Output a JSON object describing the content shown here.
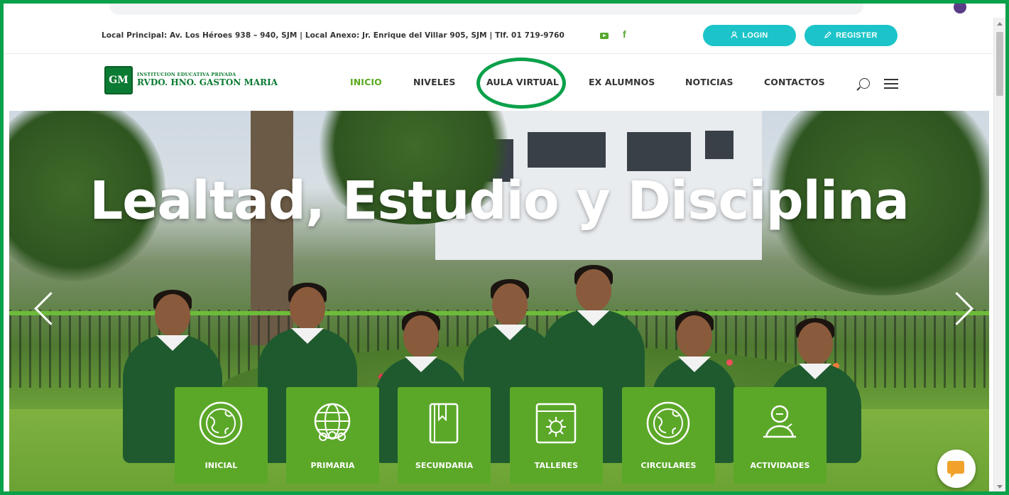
{
  "topbar": {
    "address": "Local Principal: Av. Los Héroes 938 – 940, SJM | Local Anexo: Jr. Enrique del Villar 905, SJM | Tlf. 01 719-9760",
    "login_label": "LOGIN",
    "register_label": "REGISTER"
  },
  "logo": {
    "badge": "GM",
    "subtitle": "INSTITUCION EDUCATIVA PRIVADA",
    "name": "RVDO. HNO. GASTON MARIA"
  },
  "nav": {
    "items": [
      {
        "label": "INICIO",
        "active": true
      },
      {
        "label": "NIVELES"
      },
      {
        "label": "AULA VIRTUAL",
        "highlighted": true
      },
      {
        "label": "EX ALUMNOS"
      },
      {
        "label": "NOTICIAS"
      },
      {
        "label": "CONTACTOS"
      }
    ]
  },
  "hero": {
    "headline": "Lealtad, Estudio y Disciplina"
  },
  "tiles": [
    {
      "label": "INICIAL",
      "icon": "globe-brain-icon"
    },
    {
      "label": "PRIMARIA",
      "icon": "globe-people-icon"
    },
    {
      "label": "SECUNDARIA",
      "icon": "book-icon"
    },
    {
      "label": "TALLERES",
      "icon": "gear-window-icon"
    },
    {
      "label": "CIRCULARES",
      "icon": "globe-brain-icon"
    },
    {
      "label": "ACTIVIDADES",
      "icon": "speaker-podium-icon"
    }
  ],
  "colors": {
    "brand_green": "#5ba829",
    "highlight_circle": "#0aa14a",
    "button_teal": "#1cc4c9",
    "active_nav": "#5aa91e"
  }
}
